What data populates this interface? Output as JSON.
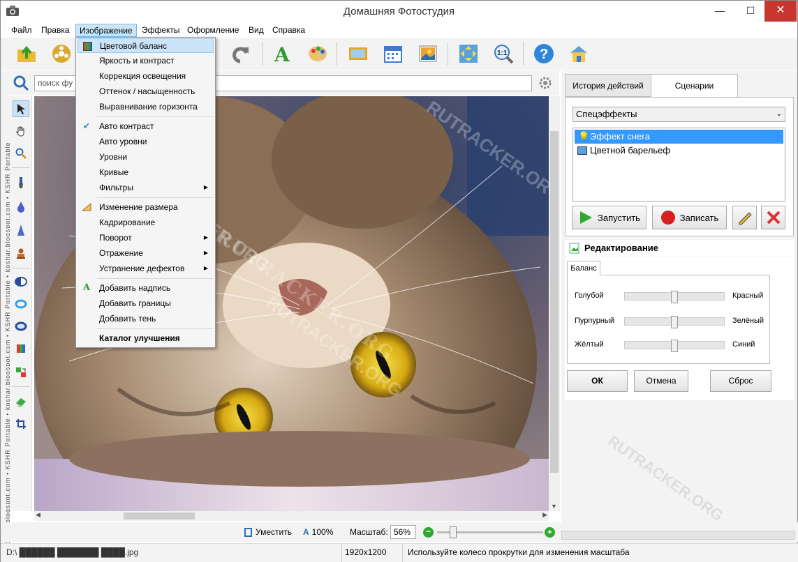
{
  "window": {
    "title": "Домашняя Фотостудия",
    "minimize": "—",
    "maximize": "☐",
    "close": "✕"
  },
  "menubar": [
    "Файл",
    "Правка",
    "Изображение",
    "Эффекты",
    "Оформление",
    "Вид",
    "Справка"
  ],
  "search": {
    "placeholder": "поиск фу"
  },
  "side_watermark": "koshar.blogspot.com • KSHR Portable • koshar.blogspot.com • KSHR Portable • koshar.blogspot.com • KSHR Portable",
  "image_menu": {
    "items": [
      {
        "label": "Цветовой баланс",
        "icon": "color-balance-icon"
      },
      {
        "label": "Яркость и контраст"
      },
      {
        "label": "Коррекция освещения"
      },
      {
        "label": "Оттенок / насыщенность"
      },
      {
        "label": "Выравнивание горизонта"
      },
      {
        "label": "Авто контраст",
        "icon": "check-icon"
      },
      {
        "label": "Авто уровни"
      },
      {
        "label": "Уровни"
      },
      {
        "label": "Кривые"
      },
      {
        "label": "Фильтры",
        "submenu": true
      },
      {
        "label": "Изменение размера",
        "icon": "resize-icon"
      },
      {
        "label": "Кадрирование"
      },
      {
        "label": "Поворот",
        "submenu": true
      },
      {
        "label": "Отражение",
        "submenu": true
      },
      {
        "label": "Устранение дефектов",
        "submenu": true
      },
      {
        "label": "Добавить надпись",
        "icon": "text-a-icon"
      },
      {
        "label": "Добавить границы"
      },
      {
        "label": "Добавить тень"
      },
      {
        "label": "Каталог улучшения"
      }
    ]
  },
  "right_panel": {
    "tabs": [
      "История действий",
      "Сценарии"
    ],
    "scenario_combo": "Спецэффекты",
    "scenarios": [
      "Эффект снега",
      "Цветной барельеф"
    ],
    "run_label": "Запустить",
    "record_label": "Записать",
    "edit_title": "Редактирование",
    "balance_tab": "Баланс",
    "sliders": [
      {
        "left": "Голубой",
        "right": "Красный",
        "value": 0
      },
      {
        "left": "Пурпурный",
        "right": "Зелёный",
        "value": 0
      },
      {
        "left": "Жёлтый",
        "right": "Синий",
        "value": 0
      }
    ],
    "ok": "ОК",
    "cancel": "Отмена",
    "reset": "Сброс"
  },
  "zoombar": {
    "fit": "Уместить",
    "actual": "100%",
    "zoom_label": "Масштаб:",
    "zoom_value": "56%"
  },
  "status": {
    "file": "D:\\ ██████ ███████ ████.jpg",
    "dims": "1920x1200",
    "hint": "Используйте колесо прокрутки для изменения масштаба"
  },
  "watermark": "RUTRACKER.ORG"
}
